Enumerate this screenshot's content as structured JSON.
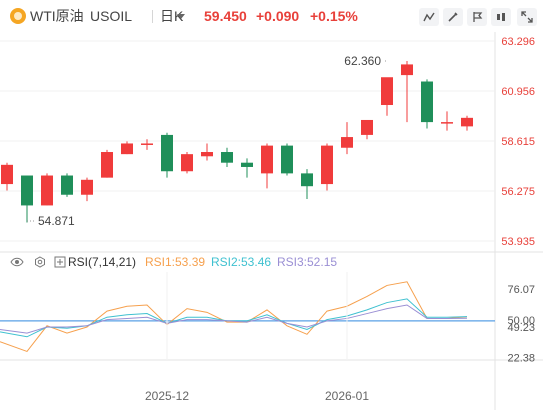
{
  "header": {
    "instrument_name": "WTI原油",
    "symbol": "USOIL",
    "period": "日K",
    "last_price": "59.450",
    "change": "+0.090",
    "change_pct": "+0.15%"
  },
  "toolbar": {
    "buttons": [
      "line-tool-icon",
      "brush-icon",
      "flag-icon",
      "compare-icon",
      "fullscreen-icon"
    ]
  },
  "colors": {
    "up": "#f03b3b",
    "down": "#1f8f5a",
    "rsi1": "#f6a04d",
    "rsi2": "#3fc1d0",
    "rsi3": "#9a8fd4",
    "level": "#5aa0e6",
    "price_text": "#e8403a"
  },
  "rsi_legend": {
    "title": "RSI(7,14,21)",
    "rsi1": "RSI1:53.39",
    "rsi2": "RSI2:53.46",
    "rsi3": "RSI3:52.15"
  },
  "chart_data": [
    {
      "type": "candlestick",
      "y_ticks": [
        "63.296",
        "60.956",
        "58.615",
        "56.275",
        "53.935"
      ],
      "ylim": [
        53.935,
        63.296
      ],
      "annotations": [
        {
          "text": "62.360",
          "value": 62.36,
          "index": 19
        },
        {
          "text": "54.871",
          "value": 54.871,
          "index": 1
        }
      ],
      "candles": [
        {
          "o": 56.6,
          "h": 57.6,
          "l": 56.3,
          "c": 57.5
        },
        {
          "o": 57.0,
          "h": 57.0,
          "l": 54.8,
          "c": 55.6
        },
        {
          "o": 55.6,
          "h": 57.1,
          "l": 55.6,
          "c": 57.0
        },
        {
          "o": 57.0,
          "h": 57.1,
          "l": 56.0,
          "c": 56.1
        },
        {
          "o": 56.1,
          "h": 56.9,
          "l": 55.8,
          "c": 56.8
        },
        {
          "o": 56.9,
          "h": 58.2,
          "l": 56.9,
          "c": 58.1
        },
        {
          "o": 58.0,
          "h": 58.6,
          "l": 58.0,
          "c": 58.5
        },
        {
          "o": 58.5,
          "h": 58.7,
          "l": 58.2,
          "c": 58.5
        },
        {
          "o": 58.9,
          "h": 59.0,
          "l": 56.9,
          "c": 57.2
        },
        {
          "o": 57.2,
          "h": 58.1,
          "l": 57.1,
          "c": 58.0
        },
        {
          "o": 57.9,
          "h": 58.5,
          "l": 57.7,
          "c": 58.1
        },
        {
          "o": 58.1,
          "h": 58.3,
          "l": 57.4,
          "c": 57.6
        },
        {
          "o": 57.6,
          "h": 57.8,
          "l": 56.9,
          "c": 57.4
        },
        {
          "o": 57.1,
          "h": 58.5,
          "l": 56.4,
          "c": 58.4
        },
        {
          "o": 58.4,
          "h": 58.5,
          "l": 57.0,
          "c": 57.1
        },
        {
          "o": 57.1,
          "h": 57.3,
          "l": 55.9,
          "c": 56.5
        },
        {
          "o": 56.6,
          "h": 58.5,
          "l": 56.3,
          "c": 58.4
        },
        {
          "o": 58.3,
          "h": 59.5,
          "l": 58.0,
          "c": 58.8
        },
        {
          "o": 58.9,
          "h": 59.5,
          "l": 58.7,
          "c": 59.6
        },
        {
          "o": 60.3,
          "h": 61.2,
          "l": 59.8,
          "c": 61.6
        },
        {
          "o": 61.7,
          "h": 62.36,
          "l": 59.5,
          "c": 62.2
        },
        {
          "o": 61.4,
          "h": 61.5,
          "l": 59.2,
          "c": 59.5
        },
        {
          "o": 59.5,
          "h": 60.0,
          "l": 59.1,
          "c": 59.5
        },
        {
          "o": 59.3,
          "h": 59.8,
          "l": 59.1,
          "c": 59.7
        }
      ]
    },
    {
      "type": "line",
      "name": "RSI",
      "y_ticks": [
        "76.07",
        "50.00",
        "49.23",
        "22.38"
      ],
      "ylim": [
        18.0,
        90.0
      ],
      "reference_line": 50.0,
      "x_ticks": [
        {
          "label": "2025-12",
          "index": 8
        },
        {
          "label": "2026-01",
          "index": 17
        }
      ],
      "series": [
        {
          "name": "RSI1",
          "values": [
            33,
            25,
            46,
            40,
            45,
            58,
            62,
            63,
            47,
            60,
            57,
            49,
            49,
            59,
            46,
            39,
            58,
            62,
            70,
            79,
            82,
            52,
            52,
            53.39
          ]
        },
        {
          "name": "RSI2",
          "values": [
            41,
            37,
            45,
            44,
            46,
            53,
            55,
            56,
            48,
            53,
            53,
            50,
            50,
            55,
            48,
            43,
            51,
            54,
            59,
            65,
            68,
            53,
            53,
            53.46
          ]
        },
        {
          "name": "RSI3",
          "values": [
            43,
            40,
            45,
            45,
            46,
            51,
            52,
            53,
            48,
            51,
            51,
            50,
            49,
            53,
            48,
            45,
            50,
            52,
            56,
            60,
            63,
            52,
            52,
            52.15
          ]
        }
      ]
    }
  ]
}
